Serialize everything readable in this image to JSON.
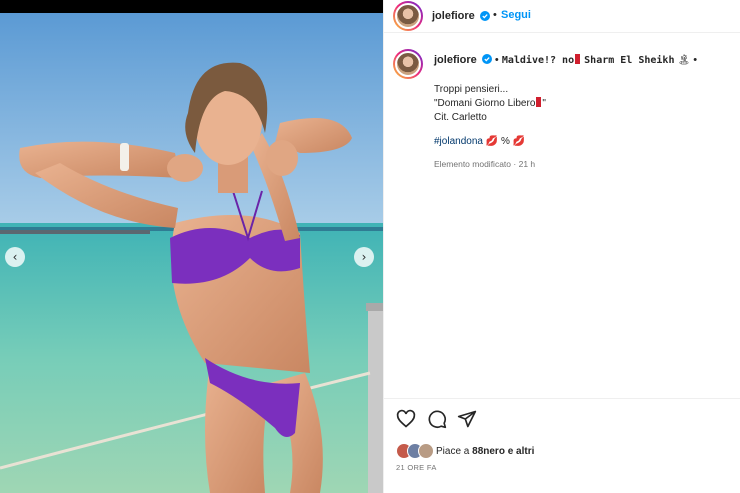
{
  "post": {
    "username": "jolefiore",
    "follow_label": "Segui",
    "separator": "•",
    "location_part1": "Maldive!? no",
    "location_part2": "Sharm El Sheikh",
    "caption_line1": "Troppi pensieri...",
    "caption_line2": "\"Domani Giorno Libero",
    "caption_line2_end": "\"",
    "caption_line3": "Cit. Carletto",
    "hashtag": "#jolandona",
    "hashtag_emojis": "💋",
    "edited_label": "Elemento modificato",
    "edited_time": "21 h",
    "likes_prefix": "Piace a",
    "likes_user": "88nero",
    "likes_suffix": "e altri",
    "timestamp": "21 ORE FA"
  },
  "icons": {
    "heart": "heart-icon",
    "comment": "comment-icon",
    "share": "share-icon",
    "verified": "verified-badge-icon",
    "prev": "chevron-left-icon",
    "next": "chevron-right-icon"
  },
  "colors": {
    "accent": "#0095f6",
    "hashtag": "#00376b",
    "muted": "#737373",
    "bikini": "#7b2fbe",
    "sea": "#5fc3b4",
    "sky": "#6aa7d8"
  }
}
